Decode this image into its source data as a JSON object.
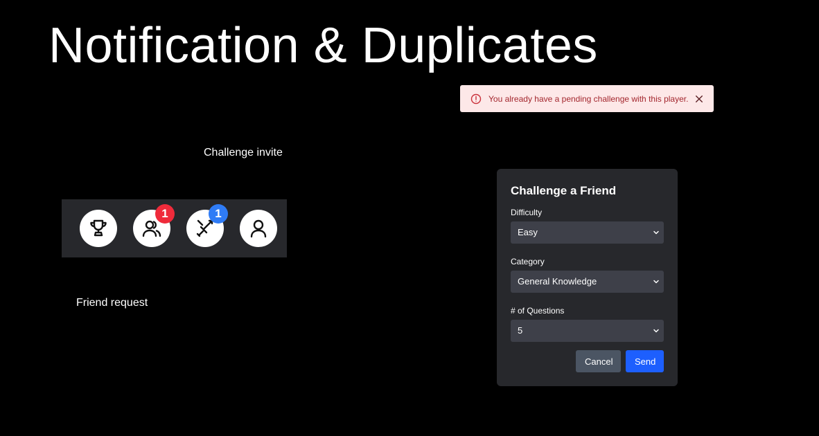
{
  "slide": {
    "title": "Notification & Duplicates",
    "captions": {
      "challenge_invite": "Challenge invite",
      "friend_request": "Friend request"
    }
  },
  "nav": {
    "items": [
      {
        "icon": "trophy-icon",
        "badge": null
      },
      {
        "icon": "friends-icon",
        "badge": "1",
        "badge_color": "#ef2b3b"
      },
      {
        "icon": "swords-icon",
        "badge": "1",
        "badge_color": "#2f7cf6"
      },
      {
        "icon": "user-icon",
        "badge": null
      }
    ]
  },
  "toast": {
    "message": "You already have a pending challenge with this player.",
    "icon": "alert-circle-icon",
    "close_icon": "close-icon",
    "background": "#fde8e8",
    "text_color": "#a3262d"
  },
  "modal": {
    "title": "Challenge a Friend",
    "fields": {
      "difficulty": {
        "label": "Difficulty",
        "value": "Easy"
      },
      "category": {
        "label": "Category",
        "value": "General Knowledge"
      },
      "questions": {
        "label": "# of Questions",
        "value": "5"
      }
    },
    "cancel_label": "Cancel",
    "send_label": "Send",
    "send_color": "#1d5ffe"
  }
}
